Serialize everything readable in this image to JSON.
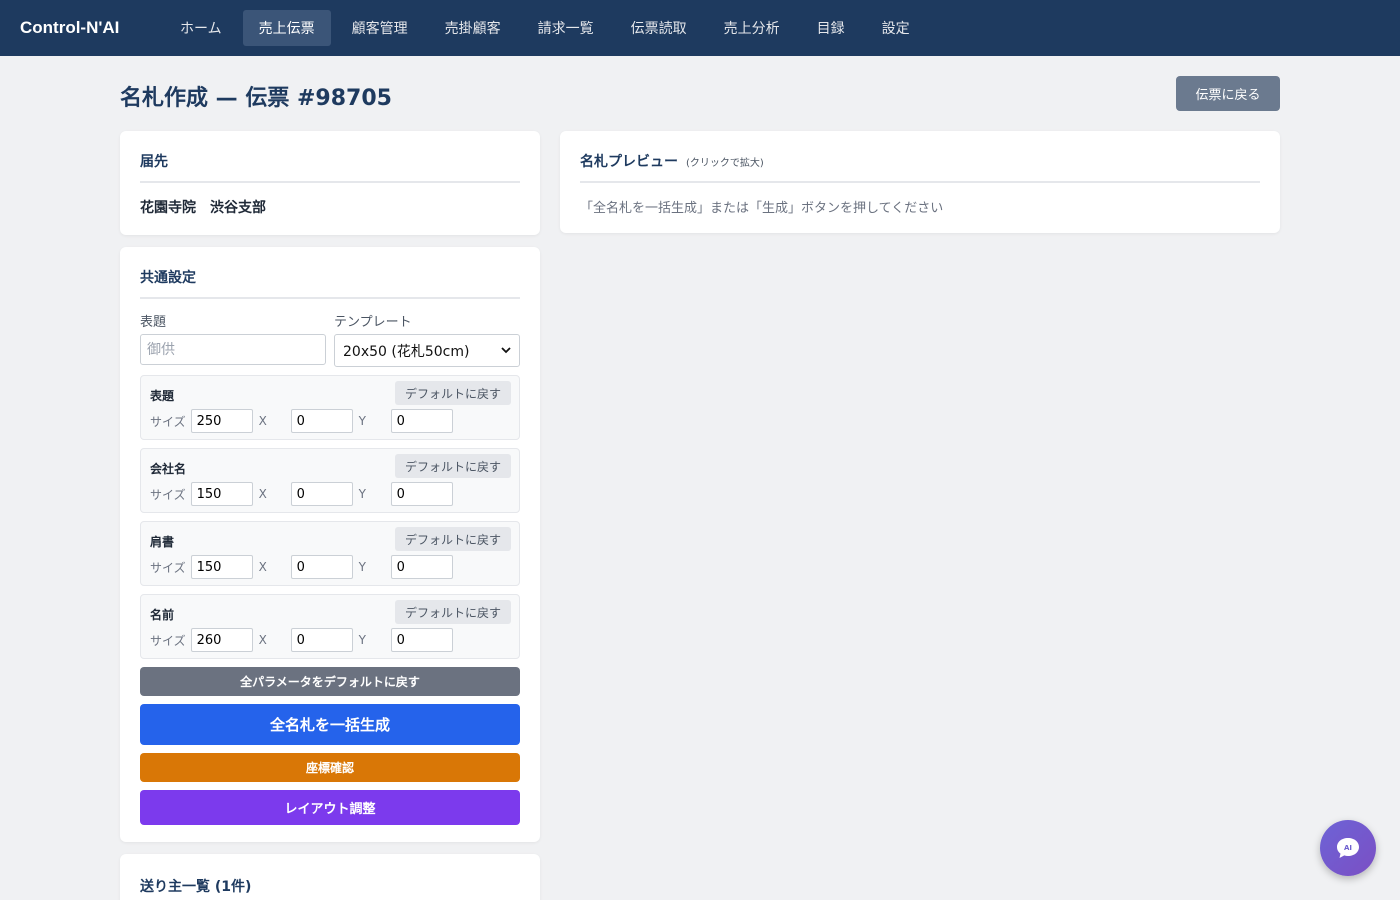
{
  "nav": {
    "brand": "Control-N'AI",
    "items": [
      "ホーム",
      "売上伝票",
      "顧客管理",
      "売掛顧客",
      "請求一覧",
      "伝票読取",
      "売上分析",
      "目録",
      "設定"
    ],
    "active_index": 1
  },
  "page": {
    "title": "名札作成 — 伝票 #98705",
    "back_label": "伝票に戻る"
  },
  "destination": {
    "title": "届先",
    "value": "花園寺院　渋谷支部"
  },
  "preview": {
    "title": "名札プレビュー",
    "hint": "(クリックで拡大)",
    "message": "「全名札を一括生成」または「生成」ボタンを押してください"
  },
  "common": {
    "title": "共通設定",
    "heading_label": "表題",
    "heading_placeholder": "御供",
    "template_label": "テンプレート",
    "template_value": "20x50 (花札50cm)",
    "reset_label": "デフォルトに戻す",
    "size_label": "サイズ",
    "x_label": "X",
    "y_label": "Y",
    "params": [
      {
        "label": "表題",
        "size": "250",
        "x": "0",
        "y": "0"
      },
      {
        "label": "会社名",
        "size": "150",
        "x": "0",
        "y": "0"
      },
      {
        "label": "肩書",
        "size": "150",
        "x": "0",
        "y": "0"
      },
      {
        "label": "名前",
        "size": "260",
        "x": "0",
        "y": "0"
      }
    ],
    "reset_all_label": "全パラメータをデフォルトに戻す",
    "generate_all_label": "全名札を一括生成",
    "coords_label": "座標確認",
    "layout_label": "レイアウト調整"
  },
  "senders": {
    "title": "送り主一覧 (1件)"
  },
  "ai_button": {
    "label": "AI",
    "icon": "chat-bubble-icon"
  },
  "colors": {
    "nav_bg": "#1e3a5f",
    "primary": "#2563eb",
    "orange": "#d97706",
    "purple": "#7c3aed",
    "gray": "#6b7280"
  }
}
